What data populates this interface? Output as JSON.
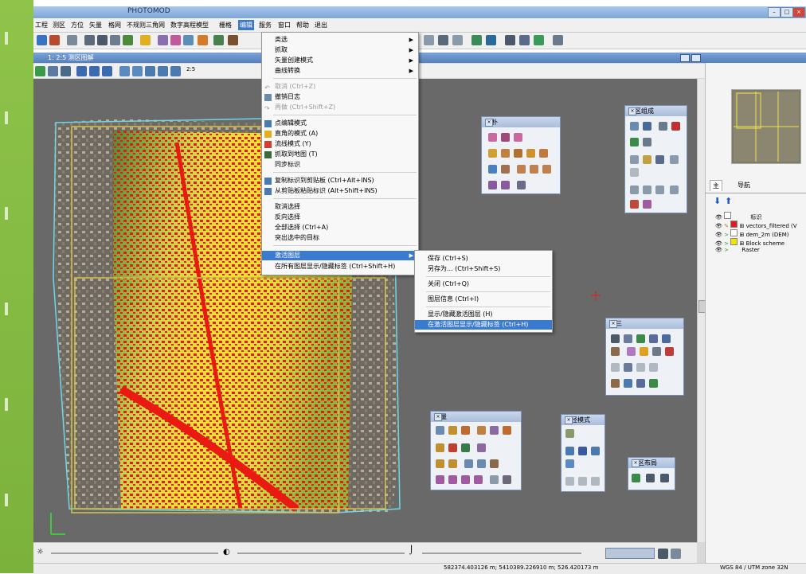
{
  "window": {
    "title": "PHOTOMOD",
    "buttons": [
      "–",
      "□",
      "×"
    ]
  },
  "menubar": {
    "items": [
      "工程",
      "测区",
      "方位",
      "矢量",
      "格网",
      "不规则三角网",
      "数字高程模型",
      "栅格",
      "编辑",
      "服务",
      "窗口",
      "帮助",
      "退出"
    ],
    "active": "编辑"
  },
  "doc": {
    "title": "1: 2:5 测区图解",
    "zoom": "2:5"
  },
  "edit_menu": {
    "items": [
      {
        "label": "类选",
        "submenu": true
      },
      {
        "label": "抓取",
        "submenu": true
      },
      {
        "label": "矢量创建模式",
        "submenu": true
      },
      {
        "label": "曲线转换",
        "submenu": true
      },
      {
        "label": "取消 (Ctrl+Z)",
        "disabled": true
      },
      {
        "label": "撤销日志"
      },
      {
        "label": "再做 (Ctrl+Shift+Z)",
        "disabled": true
      },
      {
        "label": "点编辑模式"
      },
      {
        "label": "直角的模式 (A)"
      },
      {
        "label": "流线模式 (Y)"
      },
      {
        "label": "抓取到地图 (T)"
      },
      {
        "label": "同步标识"
      },
      {
        "label": "复制标识到剪贴板 (Ctrl+Alt+INS)"
      },
      {
        "label": "从剪贴板粘贴标识 (Alt+Shift+INS)"
      },
      {
        "label": "取消选择"
      },
      {
        "label": "反向选择"
      },
      {
        "label": "全部选择 (Ctrl+A)"
      },
      {
        "label": "突出选中的目标"
      },
      {
        "label": "激活图层",
        "submenu": true,
        "highlight": true
      },
      {
        "label": "在所有图层显示/隐藏标签 (Ctrl+Shift+H)"
      }
    ]
  },
  "layer_submenu": {
    "items": [
      {
        "label": "保存 (Ctrl+S)"
      },
      {
        "label": "另存为... (Ctrl+Shift+S)"
      },
      {
        "label": "关闭 (Ctrl+Q)"
      },
      {
        "label": "图层信息 (Ctrl+I)"
      },
      {
        "label": "显示/隐藏激活图层 (H)"
      },
      {
        "label": "在激活图层显示/隐藏标签 (Ctrl+H)",
        "highlight": true
      }
    ]
  },
  "panels": {
    "topology": "拓朴",
    "block_composition": "测区组成",
    "aerotriangulation": "空三",
    "vector": "矢量",
    "route_mode": "路径模式",
    "block_layout": "测区布局"
  },
  "right_panel": {
    "tabs": [
      "主",
      "导航"
    ],
    "layers": [
      {
        "name": "标识",
        "color": "#ffffff"
      },
      {
        "name": "vectors_filtered (V",
        "color": "#e31b1b"
      },
      {
        "name": "dem_2m (DEM)",
        "color": "#ffffff"
      },
      {
        "name": "Block scheme",
        "color": "#f2e600"
      },
      {
        "name": "Raster",
        "color": ""
      }
    ]
  },
  "status": {
    "coords": "582374.403126 m; 5410389.226910 m; 526.420173 m",
    "crs": "WGS 84 / UTM zone 32N"
  },
  "colors": {
    "accent": "#3a7bd0",
    "vector": "#e31b1b",
    "block_outline": "#d9c24a",
    "block_cyan": "#6fd6e6"
  }
}
